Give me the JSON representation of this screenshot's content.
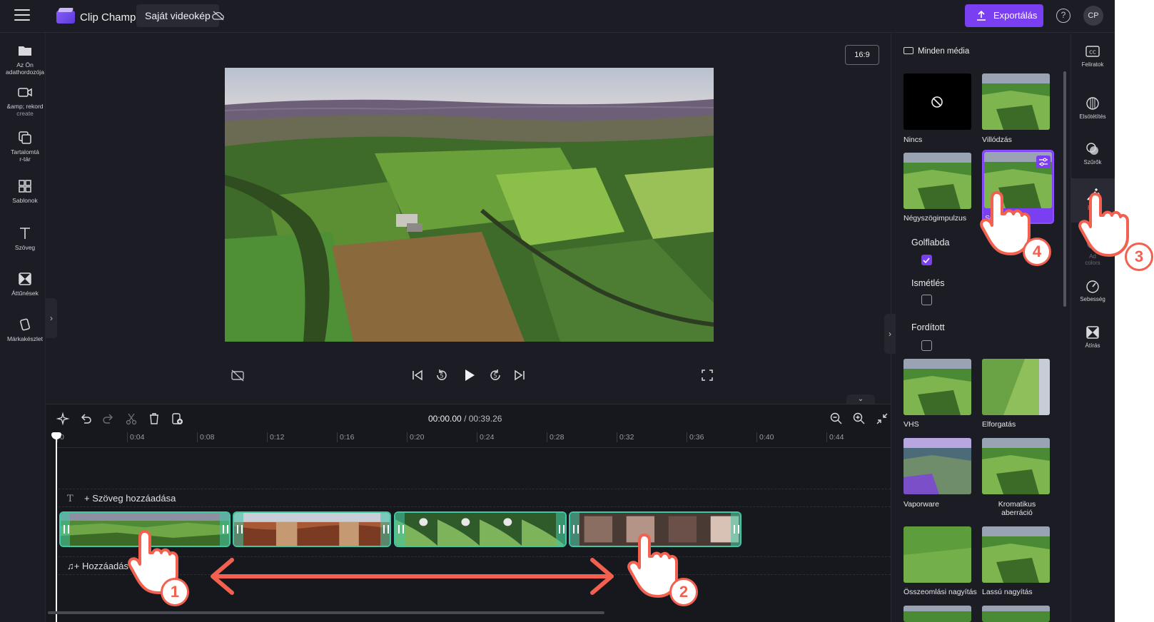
{
  "app": {
    "title": "Clip Champ",
    "project_name": "Saját videokép",
    "export_label": "Exportálás",
    "help": "?",
    "avatar_initials": "CP"
  },
  "colors": {
    "accent": "#7b3ff2",
    "clip_border": "#3fc7a6",
    "annotation": "#f2604f",
    "bg": "#1c1c24"
  },
  "left_sidebar": {
    "items": [
      {
        "icon": "folder-icon",
        "label": "Az Ön adathordozója"
      },
      {
        "icon": "camera-icon",
        "label": "&amp; rekord",
        "sublabel": "create"
      },
      {
        "icon": "content-library-icon",
        "label": "Tartalomtá",
        "sublabel": "r-tár"
      },
      {
        "icon": "templates-icon",
        "label": "Sablonok"
      },
      {
        "icon": "text-icon",
        "label": "Szöveg"
      },
      {
        "icon": "transitions-icon",
        "label": "Áttűnések"
      },
      {
        "icon": "brand-kit-icon",
        "label": "Márkakészlet"
      }
    ]
  },
  "preview": {
    "aspect_ratio": "16:9"
  },
  "timeline": {
    "current_time": "00:00.00",
    "total_time": "/ 00:39.26",
    "ticks": [
      "0",
      "0:04",
      "0:08",
      "0:12",
      "0:16",
      "0:20",
      "0:24",
      "0:28",
      "0:32",
      "0:36",
      "0:40",
      "0:44"
    ],
    "add_text": "Szöveg hozzáadása",
    "add_audio": "Hozzáadás"
  },
  "effects_panel": {
    "header": "Minden média",
    "effects": [
      {
        "label": "Nincs"
      },
      {
        "label": "Villódzás"
      },
      {
        "label": "Négyszögimpulzus"
      },
      {
        "label": "Sp"
      },
      {
        "label": "VHS"
      },
      {
        "label": "Elforgatás"
      },
      {
        "label": "Vaporware"
      },
      {
        "label": "Kromatikus aberráció"
      },
      {
        "label": "Összeomlási nagyítás"
      },
      {
        "label": "Lassú nagyítás"
      }
    ],
    "options": [
      {
        "label": "Golflabda",
        "checked": true
      },
      {
        "label": "Ismétlés",
        "checked": false
      },
      {
        "label": "Fordított",
        "checked": false
      }
    ]
  },
  "right_rail": {
    "items": [
      {
        "icon": "captions-icon",
        "label": "Feliratok"
      },
      {
        "icon": "fade-icon",
        "label": "Elsötétítés"
      },
      {
        "icon": "filters-icon",
        "label": "Szűrők"
      },
      {
        "icon": "effects-icon",
        "label": "Effe"
      },
      {
        "icon": "adjust-colors-icon",
        "label": "Ad",
        "sublabel": "colors"
      },
      {
        "icon": "speed-icon",
        "label": "Sebesség"
      },
      {
        "icon": "transition-icon",
        "label": "Átírás"
      }
    ]
  },
  "annotations": {
    "steps": [
      "1",
      "2",
      "3",
      "4"
    ]
  }
}
